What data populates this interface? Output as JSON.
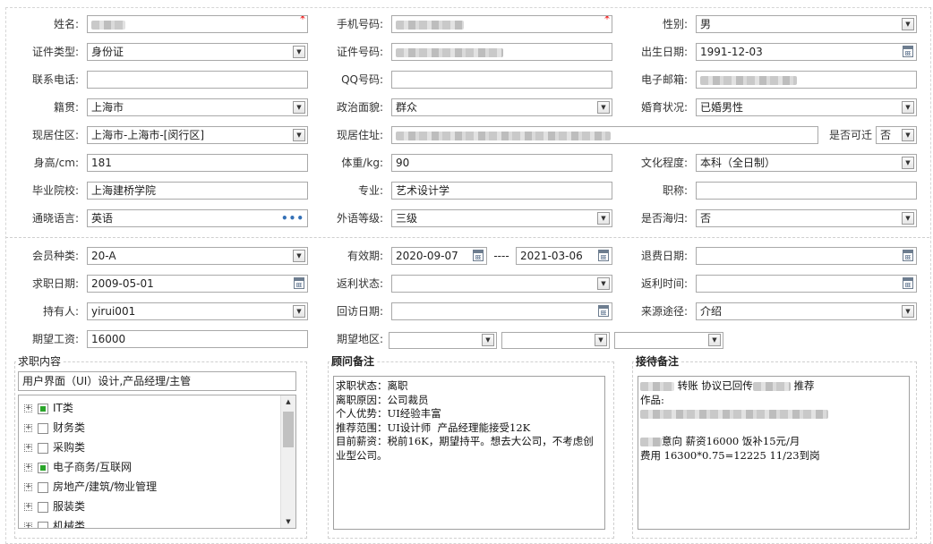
{
  "form": {
    "name": {
      "label": "姓名:",
      "value": ""
    },
    "mobile": {
      "label": "手机号码:",
      "value": ""
    },
    "gender": {
      "label": "性别:",
      "value": "男"
    },
    "id_type": {
      "label": "证件类型:",
      "value": "身份证"
    },
    "id_number": {
      "label": "证件号码:",
      "value": ""
    },
    "birth_date": {
      "label": "出生日期:",
      "value": "1991-12-03"
    },
    "contact_phone": {
      "label": "联系电话:",
      "value": ""
    },
    "qq": {
      "label": "QQ号码:",
      "value": ""
    },
    "email": {
      "label": "电子邮箱:",
      "value": ""
    },
    "native_place": {
      "label": "籍贯:",
      "value": "上海市"
    },
    "political_status": {
      "label": "政治面貌:",
      "value": "群众"
    },
    "marital_status": {
      "label": "婚育状况:",
      "value": "已婚男性"
    },
    "residence_area": {
      "label": "现居住区:",
      "value": "上海市-上海市-[闵行区]"
    },
    "residence_address": {
      "label": "现居住址:",
      "value": ""
    },
    "relocatable": {
      "label": "是否可迁",
      "value": "否"
    },
    "height": {
      "label": "身高/cm:",
      "value": "181"
    },
    "weight": {
      "label": "体重/kg:",
      "value": "90"
    },
    "education": {
      "label": "文化程度:",
      "value": "本科（全日制）"
    },
    "school": {
      "label": "毕业院校:",
      "value": "上海建桥学院"
    },
    "major": {
      "label": "专业:",
      "value": "艺术设计学"
    },
    "title": {
      "label": "职称:",
      "value": ""
    },
    "languages": {
      "label": "通晓语言:",
      "value": "英语"
    },
    "foreign_level": {
      "label": "外语等级:",
      "value": "三级"
    },
    "returnee": {
      "label": "是否海归:",
      "value": "否"
    }
  },
  "membership": {
    "member_type": {
      "label": "会员种类:",
      "value": "20-A"
    },
    "valid_period": {
      "label": "有效期:",
      "from": "2020-09-07",
      "separator": "----",
      "to": "2021-03-06"
    },
    "refund_date": {
      "label": "退费日期:",
      "value": ""
    },
    "job_seek_date": {
      "label": "求职日期:",
      "value": "2009-05-01"
    },
    "rebate_status": {
      "label": "返利状态:",
      "value": ""
    },
    "rebate_time": {
      "label": "返利时间:",
      "value": ""
    },
    "holder": {
      "label": "持有人:",
      "value": "yirui001"
    },
    "revisit_date": {
      "label": "回访日期:",
      "value": ""
    },
    "source": {
      "label": "来源途径:",
      "value": "介绍"
    },
    "expected_salary": {
      "label": "期望工资:",
      "value": "16000"
    },
    "expected_region": {
      "label": "期望地区:",
      "values": [
        "",
        "",
        ""
      ]
    }
  },
  "job_content": {
    "title": "求职内容",
    "selected": "用户界面（UI）设计,产品经理/主管",
    "categories": [
      {
        "label": "IT类",
        "checked": true
      },
      {
        "label": "财务类",
        "checked": false
      },
      {
        "label": "采购类",
        "checked": false
      },
      {
        "label": "电子商务/互联网",
        "checked": true
      },
      {
        "label": "房地产/建筑/物业管理",
        "checked": false
      },
      {
        "label": "服装类",
        "checked": false
      },
      {
        "label": "机械类",
        "checked": false
      }
    ]
  },
  "advisor_notes": {
    "title": "顾问备注",
    "text": "求职状态：离职\n离职原因：公司裁员\n个人优势：UI经验丰富\n推荐范围：UI设计师  产品经理能接受12K\n目前薪资：税前16K，期望持平。想去大公司，不考虑创业型公司。"
  },
  "reception_notes": {
    "title": "接待备注",
    "line1_a": "转账 协议已回传",
    "line1_b": "推荐",
    "line2": "作品:",
    "line3": "意向 薪资16000 饭补15元/月",
    "line4": "费用 16300*0.75=12225  11/23到岗"
  },
  "colors": {
    "required_mark": "#e00000",
    "check_green": "#2aa52a",
    "dots_blue": "#3470b6"
  }
}
